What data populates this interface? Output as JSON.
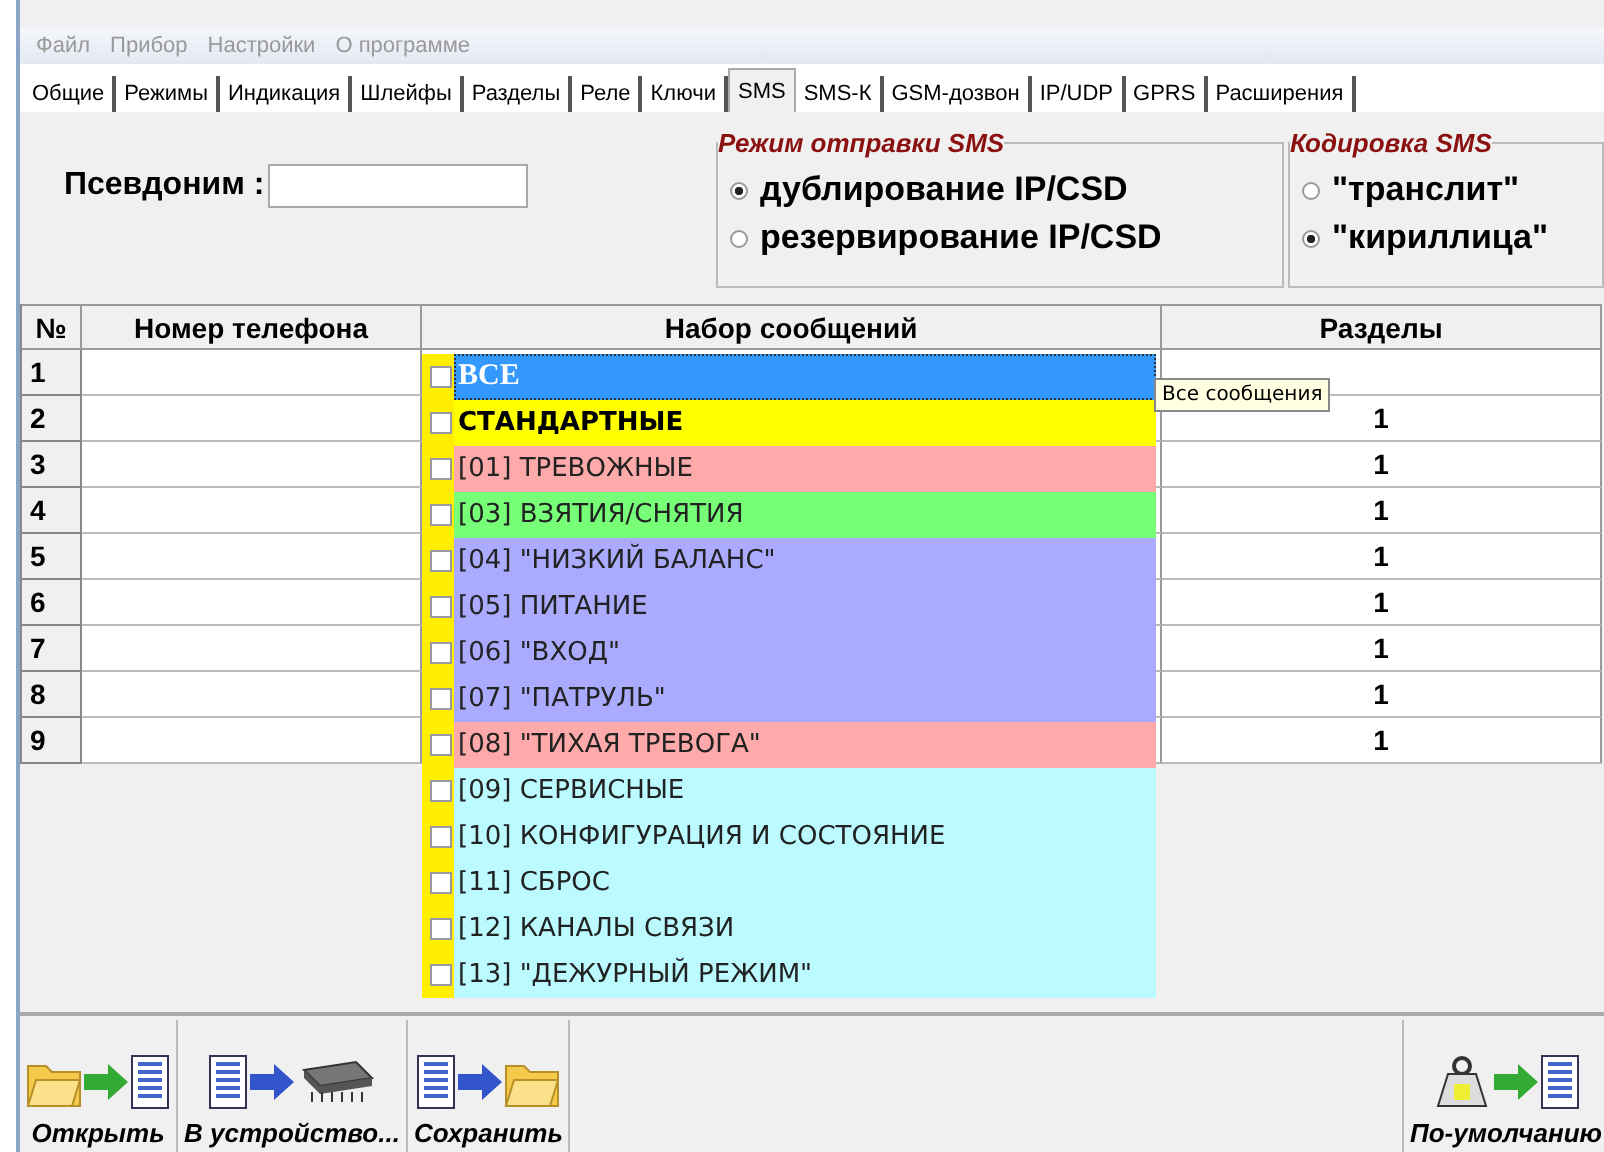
{
  "menu": [
    "Файл",
    "Прибор",
    "Настройки",
    "О программе"
  ],
  "tabs": [
    {
      "label": "Общие",
      "selected": false
    },
    {
      "label": "Режимы",
      "selected": false
    },
    {
      "label": "Индикация",
      "selected": false
    },
    {
      "label": "Шлейфы",
      "selected": false
    },
    {
      "label": "Разделы",
      "selected": false
    },
    {
      "label": "Реле",
      "selected": false
    },
    {
      "label": "Ключи",
      "selected": false
    },
    {
      "label": "SMS",
      "selected": true
    },
    {
      "label": "SMS-К",
      "selected": false
    },
    {
      "label": "GSM-дозвон",
      "selected": false
    },
    {
      "label": "IP/UDP",
      "selected": false
    },
    {
      "label": "GPRS",
      "selected": false
    },
    {
      "label": "Расширения",
      "selected": false
    }
  ],
  "alias": {
    "label": "Псевдоним :"
  },
  "send_mode": {
    "title": "Режим отправки SMS",
    "options": [
      {
        "label": "дублирование IP/CSD",
        "selected": true
      },
      {
        "label": "резервирование IP/CSD",
        "selected": false
      }
    ]
  },
  "encoding": {
    "title": "Кодировка SMS",
    "options": [
      {
        "label": "\"транслит\"",
        "selected": false
      },
      {
        "label": "\"кириллица\"",
        "selected": true
      }
    ]
  },
  "table": {
    "columns": [
      "№",
      "Номер телефона",
      "Набор сообщений",
      "Разделы"
    ],
    "rows": [
      {
        "num": "1"
      },
      {
        "num": "2",
        "sections": "1"
      },
      {
        "num": "3",
        "sections": "1"
      },
      {
        "num": "4",
        "sections": "1"
      },
      {
        "num": "5",
        "sections": "1"
      },
      {
        "num": "6",
        "sections": "1"
      },
      {
        "num": "7",
        "sections": "1"
      },
      {
        "num": "8",
        "sections": "1"
      },
      {
        "num": "9",
        "sections": "1"
      }
    ]
  },
  "message_list": [
    {
      "label": "ВСЕ",
      "kind": "all",
      "checked": false,
      "selected": true,
      "color": "#3399ff"
    },
    {
      "label": "СТАНДАРТНЫЕ",
      "kind": "group",
      "checked": false,
      "selected": false,
      "color": "#ffff00"
    },
    {
      "label": "[01] ТРЕВОЖНЫЕ",
      "kind": "item",
      "checked": false,
      "selected": false,
      "color": "#ffaaaa"
    },
    {
      "label": "[03] ВЗЯТИЯ/СНЯТИЯ",
      "kind": "item",
      "checked": false,
      "selected": false,
      "color": "#77ff77"
    },
    {
      "label": "[04] \"НИЗКИЙ БАЛАНС\"",
      "kind": "item",
      "checked": false,
      "selected": false,
      "color": "#aaaaff"
    },
    {
      "label": "[05] ПИТАНИЕ",
      "kind": "item",
      "checked": false,
      "selected": false,
      "color": "#aaaaff"
    },
    {
      "label": "[06] \"ВХОД\"",
      "kind": "item",
      "checked": false,
      "selected": false,
      "color": "#aaaaff"
    },
    {
      "label": "[07] \"ПАТРУЛЬ\"",
      "kind": "item",
      "checked": false,
      "selected": false,
      "color": "#aaaaff"
    },
    {
      "label": "[08] \"ТИХАЯ ТРЕВОГА\"",
      "kind": "item",
      "checked": false,
      "selected": false,
      "color": "#ffaaaa"
    },
    {
      "label": "[09] СЕРВИСНЫЕ",
      "kind": "item",
      "checked": false,
      "selected": false,
      "color": "#bbfbff"
    },
    {
      "label": "[10] КОНФИГУРАЦИЯ И СОСТОЯНИЕ",
      "kind": "item",
      "checked": false,
      "selected": false,
      "color": "#bbfbff"
    },
    {
      "label": "[11] СБРОС",
      "kind": "item",
      "checked": false,
      "selected": false,
      "color": "#bbfbff"
    },
    {
      "label": "[12] КАНАЛЫ СВЯЗИ",
      "kind": "item",
      "checked": false,
      "selected": false,
      "color": "#bbfbff"
    },
    {
      "label": "[13] \"ДЕЖУРНЫЙ РЕЖИМ\"",
      "kind": "item",
      "checked": false,
      "selected": false,
      "color": "#bbfbff"
    }
  ],
  "tooltip": "Все сообщения",
  "toolbar": [
    {
      "label": "Открыть",
      "kind": "open"
    },
    {
      "label": "В устройство...",
      "kind": "to-device"
    },
    {
      "label": "Сохранить",
      "kind": "save"
    },
    {
      "label": "По-умолчанию",
      "kind": "default"
    }
  ]
}
